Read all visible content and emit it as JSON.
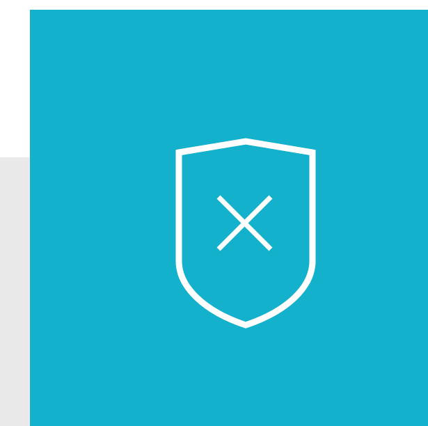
{
  "colors": {
    "panel": "#14b1cd",
    "icon": "#ffffff",
    "background_upper": "#ffffff",
    "background_lower": "#e9e9e9"
  },
  "icons": {
    "main": "shield-x-icon",
    "inner": "close-icon"
  }
}
